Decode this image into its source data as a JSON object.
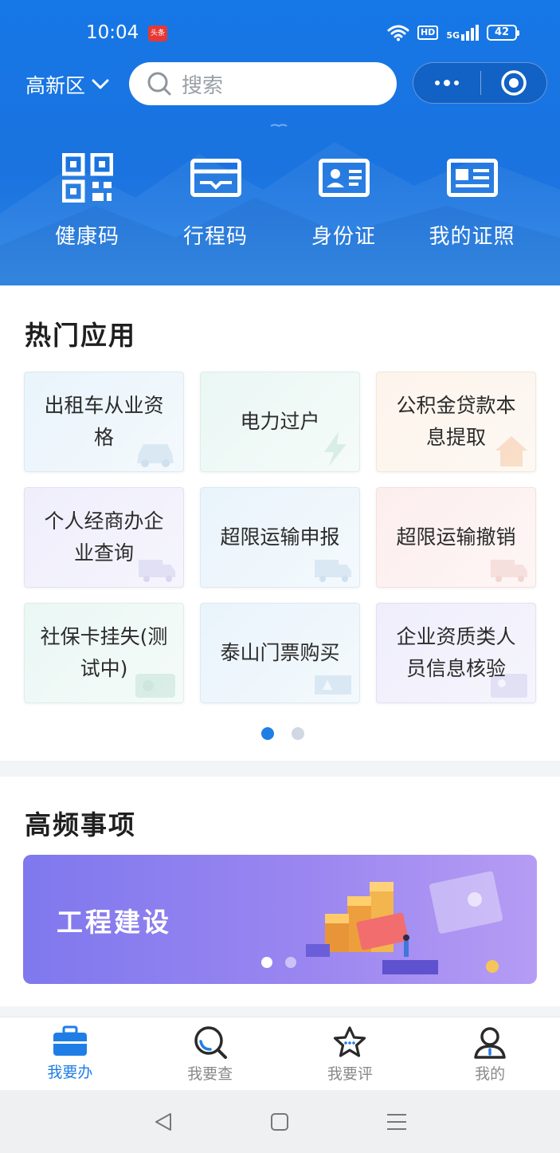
{
  "status": {
    "time": "10:04",
    "app_badge": "头条",
    "hd": "HD",
    "network": "5G",
    "battery": "42"
  },
  "header": {
    "region": "高新区",
    "search_placeholder": "搜索",
    "quick": [
      {
        "label": "健康码",
        "icon": "qr-code-icon"
      },
      {
        "label": "行程码",
        "icon": "itinerary-card-icon"
      },
      {
        "label": "身份证",
        "icon": "id-card-icon"
      },
      {
        "label": "我的证照",
        "icon": "license-icon"
      }
    ]
  },
  "hot": {
    "title": "热门应用",
    "items": [
      {
        "label": "出租车从业资格",
        "theme": "c-blue",
        "icon": "taxi-icon"
      },
      {
        "label": "电力过户",
        "theme": "c-green",
        "icon": "lightning-icon"
      },
      {
        "label": "公积金贷款本息提取",
        "theme": "c-orange",
        "icon": "house-icon"
      },
      {
        "label": "个人经商办企业查询",
        "theme": "c-purple",
        "icon": "truck-icon"
      },
      {
        "label": "超限运输申报",
        "theme": "c-blue",
        "icon": "truck-icon"
      },
      {
        "label": "超限运输撤销",
        "theme": "c-red",
        "icon": "truck-icon"
      },
      {
        "label": "社保卡挂失(测试中)",
        "theme": "c-green",
        "icon": "social-card-icon"
      },
      {
        "label": "泰山门票购买",
        "theme": "c-blue",
        "icon": "ticket-icon"
      },
      {
        "label": "企业资质类人员信息核验",
        "theme": "c-purple",
        "icon": "id-card-icon"
      }
    ]
  },
  "freq": {
    "title": "高频事项",
    "banner_title": "工程建设"
  },
  "tabs": [
    {
      "label": "我要办",
      "icon": "briefcase-icon",
      "active": true
    },
    {
      "label": "我要查",
      "icon": "search-icon",
      "active": false
    },
    {
      "label": "我要评",
      "icon": "star-icon",
      "active": false
    },
    {
      "label": "我的",
      "icon": "user-icon",
      "active": false
    }
  ],
  "colors": {
    "primary": "#1f7ee6",
    "header": "#1677e6",
    "banner": "#8f80ef"
  }
}
